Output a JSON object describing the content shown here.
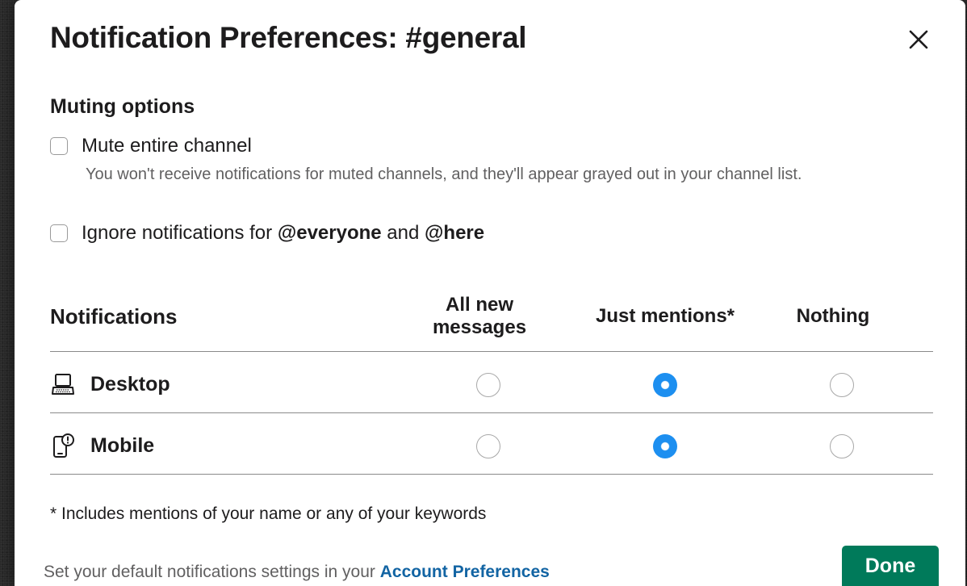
{
  "dialog": {
    "title": "Notification Preferences: #general",
    "close_icon": "close-icon"
  },
  "muting": {
    "heading": "Muting options",
    "mute_channel": {
      "label": "Mute entire channel",
      "checked": false,
      "help": "You won't receive notifications for muted channels, and they'll appear grayed out in your channel list."
    },
    "ignore_everyone": {
      "label_prefix": "Ignore notifications for",
      "everyone": "@everyone",
      "and": "and",
      "here": "@here",
      "checked": false
    }
  },
  "notifications": {
    "heading": "Notifications",
    "columns": [
      "All new messages",
      "Just mentions*",
      "Nothing"
    ],
    "rows": [
      {
        "label": "Desktop",
        "icon": "desktop-icon",
        "selected": "Just mentions*"
      },
      {
        "label": "Mobile",
        "icon": "mobile-icon",
        "selected": "Just mentions*"
      }
    ],
    "accent_color": "#1d8ff0"
  },
  "footnote": "* Includes mentions of your name or any of your keywords",
  "footer": {
    "text": "Set your default notifications settings in your",
    "link": "Account Preferences",
    "link_color": "#1264a3",
    "done_label": "Done",
    "done_color": "#007a5a"
  }
}
